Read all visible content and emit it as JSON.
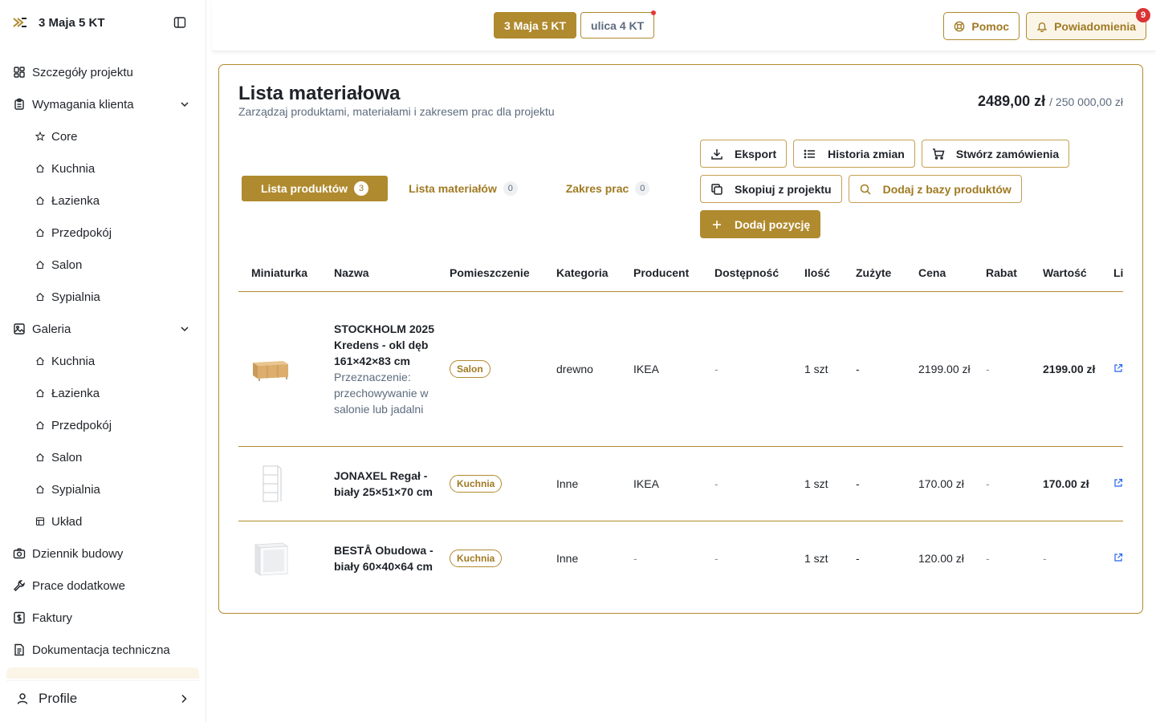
{
  "app": {
    "title": "3 Maja 5 KT"
  },
  "sidebar": {
    "items": [
      {
        "label": "Szczegóły projektu",
        "icon": "dashboard-icon"
      },
      {
        "label": "Wymagania klienta",
        "icon": "clipboard-icon",
        "expanded": true,
        "children": [
          {
            "label": "Core",
            "icon": "star-icon"
          },
          {
            "label": "Kuchnia",
            "icon": "home-icon"
          },
          {
            "label": "Łazienka",
            "icon": "home-icon"
          },
          {
            "label": "Przedpokój",
            "icon": "home-icon"
          },
          {
            "label": "Salon",
            "icon": "home-icon"
          },
          {
            "label": "Sypialnia",
            "icon": "home-icon"
          }
        ]
      },
      {
        "label": "Galeria",
        "icon": "image-icon",
        "expanded": true,
        "children": [
          {
            "label": "Kuchnia",
            "icon": "home-icon"
          },
          {
            "label": "Łazienka",
            "icon": "home-icon"
          },
          {
            "label": "Przedpokój",
            "icon": "home-icon"
          },
          {
            "label": "Salon",
            "icon": "home-icon"
          },
          {
            "label": "Sypialnia",
            "icon": "home-icon"
          },
          {
            "label": "Układ",
            "icon": "layout-icon"
          }
        ]
      },
      {
        "label": "Dziennik budowy",
        "icon": "camera-icon"
      },
      {
        "label": "Prace dodatkowe",
        "icon": "wrench-icon"
      },
      {
        "label": "Faktury",
        "icon": "dollar-icon"
      },
      {
        "label": "Dokumentacja techniczna",
        "icon": "document-icon"
      }
    ],
    "footer": {
      "label": "Profile",
      "icon": "user-icon"
    }
  },
  "topbar": {
    "projects": [
      {
        "label": "3 Maja 5 KT",
        "active": true
      },
      {
        "label": "ulica 4 KT",
        "active": false,
        "has_dot": true
      }
    ],
    "help_label": "Pomoc",
    "notifications_label": "Powiadomienia",
    "notifications_count": "9"
  },
  "main": {
    "title": "Lista materiałowa",
    "subtitle": "Zarządzaj produktami, materiałami i zakresem prac dla projektu",
    "budget_used": "2489,00 zł",
    "budget_limit": "/ 250 000,00 zł",
    "tabs": [
      {
        "label": "Lista produktów",
        "count": "3",
        "active": true
      },
      {
        "label": "Lista materiałów",
        "count": "0",
        "active": false
      },
      {
        "label": "Zakres prac",
        "count": "0",
        "active": false
      }
    ],
    "actions": {
      "export": "Eksport",
      "history": "Historia zmian",
      "create_orders": "Stwórz zamówienia",
      "copy_from_project": "Skopiuj z projektu",
      "add_from_db": "Dodaj z bazy produktów",
      "add_item": "Dodaj pozycję"
    },
    "table": {
      "columns": [
        "Miniaturka",
        "Nazwa",
        "Pomieszczenie",
        "Kategoria",
        "Producent",
        "Dostępność",
        "Ilość",
        "Zużyte",
        "Cena",
        "Rabat",
        "Wartość",
        "Li"
      ],
      "rows": [
        {
          "name": "STOCKHOLM 2025 Kredens - okl dęb 161×42×83 cm",
          "description": "Przeznaczenie: przechowywanie w salonie lub jadalni",
          "room": "Salon",
          "category": "drewno",
          "producer": "IKEA",
          "availability": "-",
          "quantity": "1 szt",
          "used": "-",
          "price": "2199.00 zł",
          "discount": "-",
          "value": "2199.00 zł",
          "thumb": "sideboard"
        },
        {
          "name": "JONAXEL Regał - biały 25×51×70 cm",
          "description": "",
          "room": "Kuchnia",
          "category": "Inne",
          "producer": "IKEA",
          "availability": "-",
          "quantity": "1 szt",
          "used": "-",
          "price": "170.00 zł",
          "discount": "-",
          "value": "170.00 zł",
          "thumb": "shelf"
        },
        {
          "name": "BESTÅ Obudowa - biały 60×40×64 cm",
          "description": "",
          "room": "Kuchnia",
          "category": "Inne",
          "producer": "-",
          "availability": "-",
          "quantity": "1 szt",
          "used": "-",
          "price": "120.00 zł",
          "discount": "-",
          "value": "-",
          "thumb": "cabinet"
        }
      ]
    }
  },
  "colors": {
    "accent": "#b08a2e",
    "accent_text": "#a07a22",
    "badge_red": "#d93535",
    "muted_text": "#5d6b7e"
  }
}
